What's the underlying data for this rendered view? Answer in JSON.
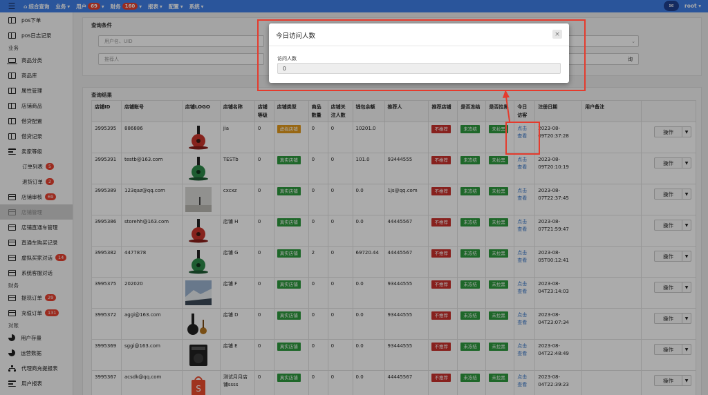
{
  "topbar": {
    "brand": "综合查询",
    "menu": [
      {
        "label": "业务",
        "caret": "▾"
      },
      {
        "label": "用户",
        "badge": "69",
        "caret": "▾"
      },
      {
        "label": "财务",
        "badge": "160",
        "caret": "▾"
      },
      {
        "label": "报表",
        "caret": "▾"
      },
      {
        "label": "配置",
        "caret": "▾"
      },
      {
        "label": "系统",
        "caret": "▾"
      }
    ],
    "user": "root",
    "user_caret": "▾",
    "chat_icon": "chat-bubble-icon"
  },
  "sidebar": {
    "items": [
      {
        "label": "pos下单",
        "icon": "book"
      },
      {
        "label": "pos日志记录",
        "icon": "book"
      },
      {
        "group": "业务"
      },
      {
        "label": "商品分类",
        "icon": "laptop"
      },
      {
        "label": "商品库",
        "icon": "book"
      },
      {
        "label": "属性管理",
        "icon": "book"
      },
      {
        "label": "店铺商品",
        "icon": "book"
      },
      {
        "label": "借贷配置",
        "icon": "book"
      },
      {
        "label": "借贷记录",
        "icon": "book"
      },
      {
        "label": "卖家等级",
        "icon": "bars"
      },
      {
        "label": "订单列表",
        "badge": "5",
        "sub": true
      },
      {
        "label": "退货订单",
        "badge": "2",
        "sub": true
      },
      {
        "label": "店铺审核",
        "badge": "69",
        "icon": "card"
      },
      {
        "label": "店铺管理",
        "icon": "card",
        "active": true
      },
      {
        "label": "店铺直通车管理",
        "icon": "card"
      },
      {
        "label": "直通车购买记录",
        "icon": "card"
      },
      {
        "label": "虚拟买家对话",
        "badge": "14",
        "icon": "card"
      },
      {
        "label": "系统客服对话",
        "icon": "card"
      },
      {
        "group": "财务"
      },
      {
        "label": "提现订单",
        "badge": "29",
        "icon": "card"
      },
      {
        "label": "充值订单",
        "badge": "131",
        "icon": "card"
      },
      {
        "group": "对账"
      },
      {
        "label": "用户存量",
        "icon": "pie"
      },
      {
        "label": "运营数据",
        "icon": "pie"
      },
      {
        "label": "代理商充提报表",
        "icon": "tree"
      },
      {
        "label": "用户报表",
        "icon": "bars"
      }
    ]
  },
  "query": {
    "title": "查询条件",
    "field1_placeholder": "用户名、UID",
    "field2_placeholder": "推荐人",
    "field3_visible_text": "询"
  },
  "results": {
    "title": "查询结果",
    "headers": [
      "店铺ID",
      "店铺账号",
      "店铺LOGO",
      "店铺名称",
      "店铺等级",
      "店铺类型",
      "商品数量",
      "店铺关注人数",
      "钱包余额",
      "推荐人",
      "推荐店铺",
      "是否冻结",
      "是否拉黑",
      "今日访客",
      "注册日期",
      "用户备注",
      ""
    ],
    "action_label": "操作",
    "visitor_link": "点击查看",
    "rows": [
      {
        "id": "3995395",
        "account": "886886",
        "logo": "guitar-red",
        "name": "jia",
        "level": "0",
        "type": "虚拟店铺",
        "type_color": "orange",
        "goods": "0",
        "fans": "0",
        "wallet": "10201.0",
        "referrer": "",
        "recommend": "不推荐",
        "frozen": "未冻结",
        "blacklist": "未拉黑",
        "date": "2023-08-09T20:37:28"
      },
      {
        "id": "3995391",
        "account": "testb@163.com",
        "logo": "guitar-green",
        "name": "TESTb",
        "level": "0",
        "type": "真实店铺",
        "type_color": "green",
        "goods": "0",
        "fans": "0",
        "wallet": "101.0",
        "referrer": "93444555",
        "recommend": "不推荐",
        "frozen": "未冻结",
        "blacklist": "未拉黑",
        "date": "2023-08-09T20:10:19"
      },
      {
        "id": "3995389",
        "account": "123qaz@qq.com",
        "logo": "landscape-fog",
        "name": "cxcxz",
        "level": "0",
        "type": "真实店铺",
        "type_color": "green",
        "goods": "0",
        "fans": "0",
        "wallet": "0.0",
        "referrer": "1js@qq.com",
        "recommend": "不推荐",
        "frozen": "未冻结",
        "blacklist": "未拉黑",
        "date": "2023-08-07T22:37:45"
      },
      {
        "id": "3995386",
        "account": "storehh@163.com",
        "logo": "guitar-red",
        "name": "店铺 H",
        "level": "0",
        "type": "真实店铺",
        "type_color": "green",
        "goods": "0",
        "fans": "0",
        "wallet": "0.0",
        "referrer": "44445567",
        "recommend": "不推荐",
        "frozen": "未冻结",
        "blacklist": "未拉黑",
        "date": "2023-08-07T21:59:47"
      },
      {
        "id": "3995382",
        "account": "4477878",
        "logo": "guitar-green",
        "name": "店铺 G",
        "level": "0",
        "type": "真实店铺",
        "type_color": "green",
        "goods": "2",
        "fans": "0",
        "wallet": "69720.44",
        "referrer": "44445567",
        "recommend": "不推荐",
        "frozen": "未冻结",
        "blacklist": "未拉黑",
        "date": "2023-08-05T00:12:41"
      },
      {
        "id": "3995375",
        "account": "202020",
        "logo": "landscape-sky",
        "name": "店铺 F",
        "level": "0",
        "type": "真实店铺",
        "type_color": "green",
        "goods": "0",
        "fans": "0",
        "wallet": "0.0",
        "referrer": "93444555",
        "recommend": "不推荐",
        "frozen": "未冻结",
        "blacklist": "未拉黑",
        "date": "2023-08-04T23:14:03"
      },
      {
        "id": "3995372",
        "account": "aggi@163.com",
        "logo": "instruments",
        "name": "店铺 D",
        "level": "0",
        "type": "真实店铺",
        "type_color": "green",
        "goods": "0",
        "fans": "0",
        "wallet": "0.0",
        "referrer": "93444555",
        "recommend": "不推荐",
        "frozen": "未冻结",
        "blacklist": "未拉黑",
        "date": "2023-08-04T23:07:34"
      },
      {
        "id": "3995369",
        "account": "sggi@163.com",
        "logo": "amplifier",
        "name": "店铺 E",
        "level": "0",
        "type": "真实店铺",
        "type_color": "green",
        "goods": "0",
        "fans": "0",
        "wallet": "0.0",
        "referrer": "93444555",
        "recommend": "不推荐",
        "frozen": "未冻结",
        "blacklist": "未拉黑",
        "date": "2023-08-04T22:48:49"
      },
      {
        "id": "3995367",
        "account": "acsdk@qq.com",
        "logo": "shopping-bag",
        "name": "测试月月店铺ssss",
        "level": "0",
        "type": "真实店铺",
        "type_color": "green",
        "goods": "0",
        "fans": "0",
        "wallet": "0.0",
        "referrer": "44445567",
        "recommend": "不推荐",
        "frozen": "未冻结",
        "blacklist": "未拉黑",
        "date": "2023-08-04T22:39:23"
      }
    ]
  },
  "modal": {
    "title": "今日访问人数",
    "close": "×",
    "label": "访问人数",
    "value": "0"
  },
  "colors": {
    "topbar": "#3f7fe8",
    "badge": "#e8412f",
    "tag_red": "#c9302c",
    "tag_green": "#2e9a3e",
    "tag_orange": "#e39a1b",
    "link": "#3a78c9",
    "annotation": "#e53b2d"
  }
}
